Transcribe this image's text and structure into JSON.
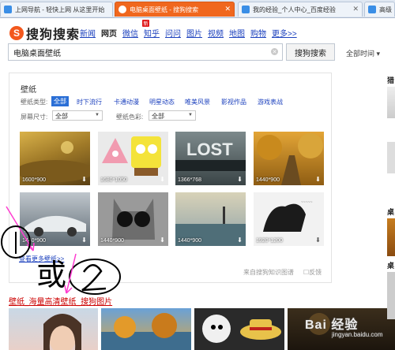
{
  "tabs": [
    {
      "label": "上网导航 - 轻快上网 从这里开始",
      "fav_color": "#3a8ee6"
    },
    {
      "label": "电脑桌面壁纸 - 搜狗搜索",
      "fav_color": "#ffffff"
    },
    {
      "label": "我的经验_个人中心_百度经验",
      "fav_color": "#3a8ee6"
    },
    {
      "label": "高级",
      "fav_color": "#3a8ee6"
    }
  ],
  "header": {
    "logo_glyph": "S",
    "logo_text": "搜狗搜索",
    "nav": [
      "新闻",
      "网页",
      "微信",
      "知乎",
      "问问",
      "图片",
      "视频",
      "地图",
      "购物",
      "更多>>"
    ],
    "new_badge": "新",
    "search_value": "电脑桌面壁纸",
    "clear_glyph": "✕",
    "search_button": "搜狗搜索",
    "time_filter": "全部时间 ▾"
  },
  "card": {
    "title": "壁纸",
    "type_label": "壁纸类型:",
    "types": [
      "全部",
      "时下流行",
      "卡通动漫",
      "明星动态",
      "唯美风景",
      "影视作品",
      "游戏表战"
    ],
    "size_label": "屏幕尺寸:",
    "size_value": "全部",
    "color_label": "壁纸色彩:",
    "color_value": "全部",
    "caret": "▼",
    "thumbs": [
      {
        "res": "1600*900"
      },
      {
        "res": "1680*1050"
      },
      {
        "res": "1366*768"
      },
      {
        "res": "1440*900"
      },
      {
        "res": "1440*900"
      },
      {
        "res": "1440*900"
      },
      {
        "res": "1440*900"
      },
      {
        "res": "1920*1200"
      }
    ],
    "download_glyph": "⬇",
    "more_link": "查看更多壁纸>>",
    "source": "来自搜狗知识图谱",
    "feedback": "☐反馈"
  },
  "result_link": "壁纸_海量高清壁纸_搜狗图片",
  "right_labels": [
    "猎",
    "桌",
    "桌"
  ],
  "annotations": {
    "circle1": "①",
    "huo": "或",
    "circle2": "②"
  },
  "watermark": "Bai 经验",
  "watermark_url": "jingyan.baidu.com",
  "colors": {
    "accent": "#f0671e",
    "link": "#1a3fbd",
    "red_link": "#c00000"
  }
}
